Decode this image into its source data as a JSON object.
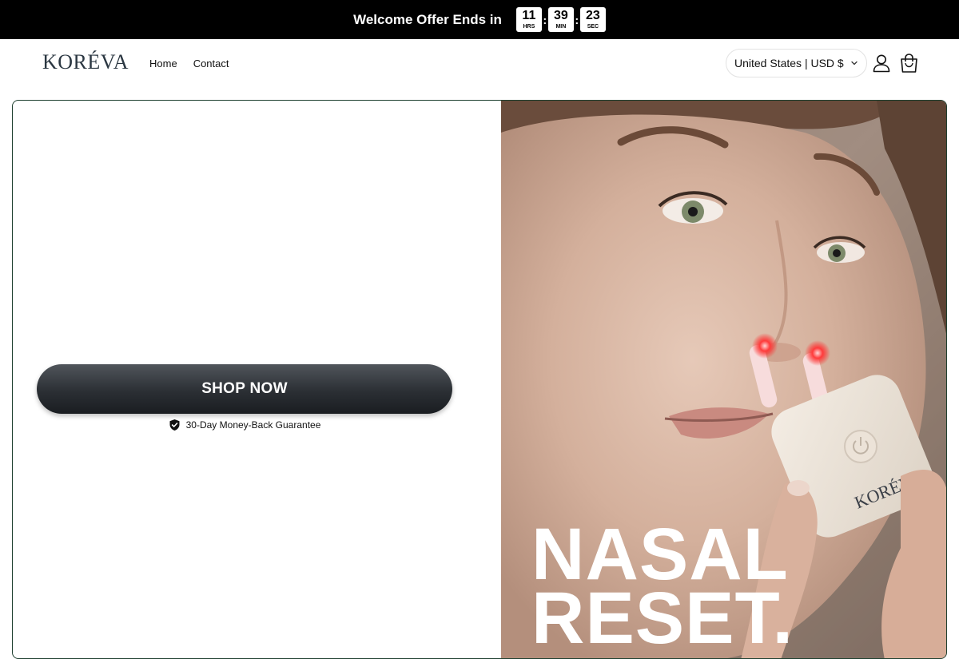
{
  "announcement": {
    "text": "Welcome Offer Ends in",
    "countdown": [
      {
        "value": "11",
        "unit": "HRS"
      },
      {
        "value": "39",
        "unit": "MIN"
      },
      {
        "value": "23",
        "unit": "SEC"
      }
    ],
    "separator": ":"
  },
  "header": {
    "logo": "KORÉVA",
    "nav": [
      "Home",
      "Contact"
    ],
    "country_selector": "United States | USD $",
    "icons": [
      "account-icon",
      "cart-icon",
      "chevron-down-icon"
    ]
  },
  "hero": {
    "cta_label": "SHOP NOW",
    "guarantee": "30-Day Money-Back Guarantee",
    "guarantee_icon": "shield-check-icon",
    "device_brand": "KORÉVA",
    "headline": [
      "NASAL",
      "RESET."
    ]
  },
  "colors": {
    "announcement_bg": "#000000",
    "cta_bg": "#2b2f34",
    "hero_border": "#1f4030",
    "logo": "#2b3742"
  }
}
